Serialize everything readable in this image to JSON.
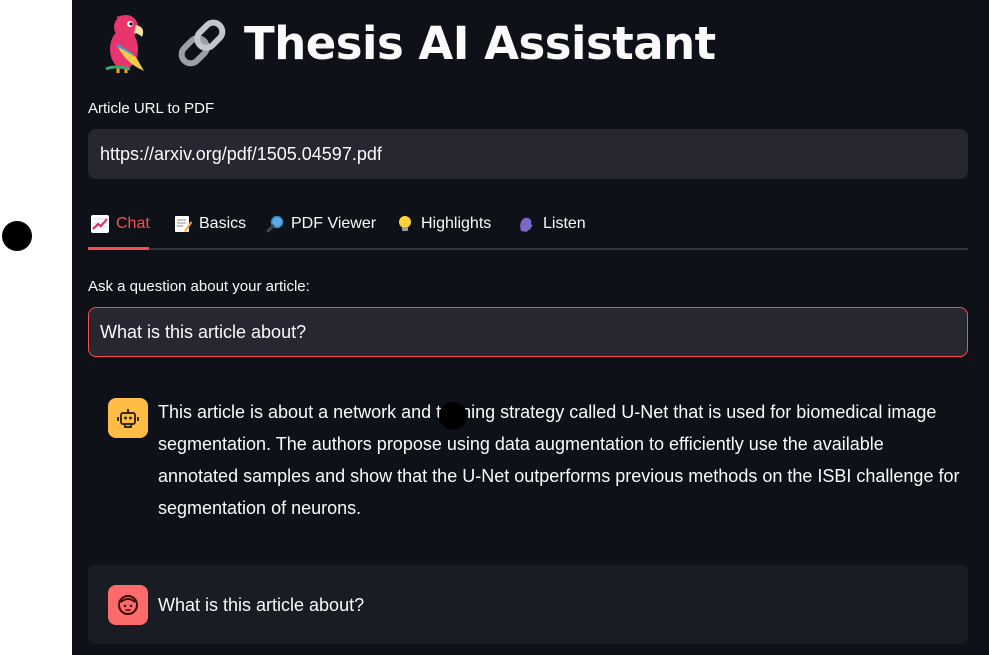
{
  "app": {
    "title": "Thesis AI Assistant",
    "title_icons": [
      "parrot-emoji",
      "link-emoji"
    ]
  },
  "url_field": {
    "label": "Article URL to PDF",
    "value": "https://arxiv.org/pdf/1505.04597.pdf"
  },
  "tabs": [
    {
      "icon": "chart-increasing-emoji",
      "label": "Chat",
      "active": true
    },
    {
      "icon": "memo-emoji",
      "label": "Basics",
      "active": false
    },
    {
      "icon": "magnifier-emoji",
      "label": "PDF Viewer",
      "active": false
    },
    {
      "icon": "light-bulb-emoji",
      "label": "Highlights",
      "active": false
    },
    {
      "icon": "speaking-head-emoji",
      "label": "Listen",
      "active": false
    }
  ],
  "question_field": {
    "label": "Ask a question about your article:",
    "value": "What is this article about?"
  },
  "messages": [
    {
      "role": "assistant",
      "avatar": "robot-icon",
      "text": "This article is about a network and training strategy called U-Net that is used for biomedical image segmentation. The authors propose using data augmentation to efficiently use the available annotated samples and show that the U-Net outperforms previous methods on the ISBI challenge for segmentation of neurons."
    },
    {
      "role": "user",
      "avatar": "face-icon",
      "text": "What is this article about?"
    }
  ],
  "colors": {
    "background": "#0e1117",
    "input_bg": "#262730",
    "accent": "#ff4b4b",
    "bot_avatar": "#ffbd45",
    "user_avatar": "#ff6b6b"
  }
}
